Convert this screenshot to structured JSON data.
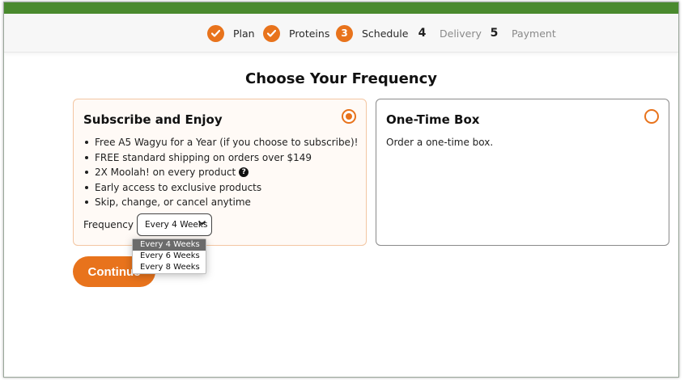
{
  "colors": {
    "brand_green": "#4a8a2e",
    "accent_orange": "#e8731c"
  },
  "steps": [
    {
      "label": "Plan",
      "state": "done",
      "icon": "check-icon"
    },
    {
      "label": "Proteins",
      "state": "done",
      "icon": "check-icon"
    },
    {
      "number": "3",
      "label": "Schedule",
      "state": "current"
    },
    {
      "number": "4",
      "label": "Delivery",
      "state": "upcoming"
    },
    {
      "number": "5",
      "label": "Payment",
      "state": "upcoming"
    }
  ],
  "title": "Choose Your Frequency",
  "subscribe": {
    "title": "Subscribe and Enjoy",
    "selected": true,
    "benefits": [
      "Free A5 Wagyu for a Year (if you choose to subscribe)!",
      "FREE standard shipping on orders over $149",
      "2X Moolah! on every product",
      "Early access to exclusive products",
      "Skip, change, or cancel anytime"
    ],
    "help_icon": "?",
    "frequency_label": "Frequency",
    "frequency_value": "Every 4 Weeks",
    "frequency_options": [
      "Every 4 Weeks",
      "Every 6 Weeks",
      "Every 8 Weeks"
    ]
  },
  "one_time": {
    "title": "One-Time Box",
    "description": "Order a one-time box.",
    "selected": false
  },
  "continue_label": "Continue"
}
